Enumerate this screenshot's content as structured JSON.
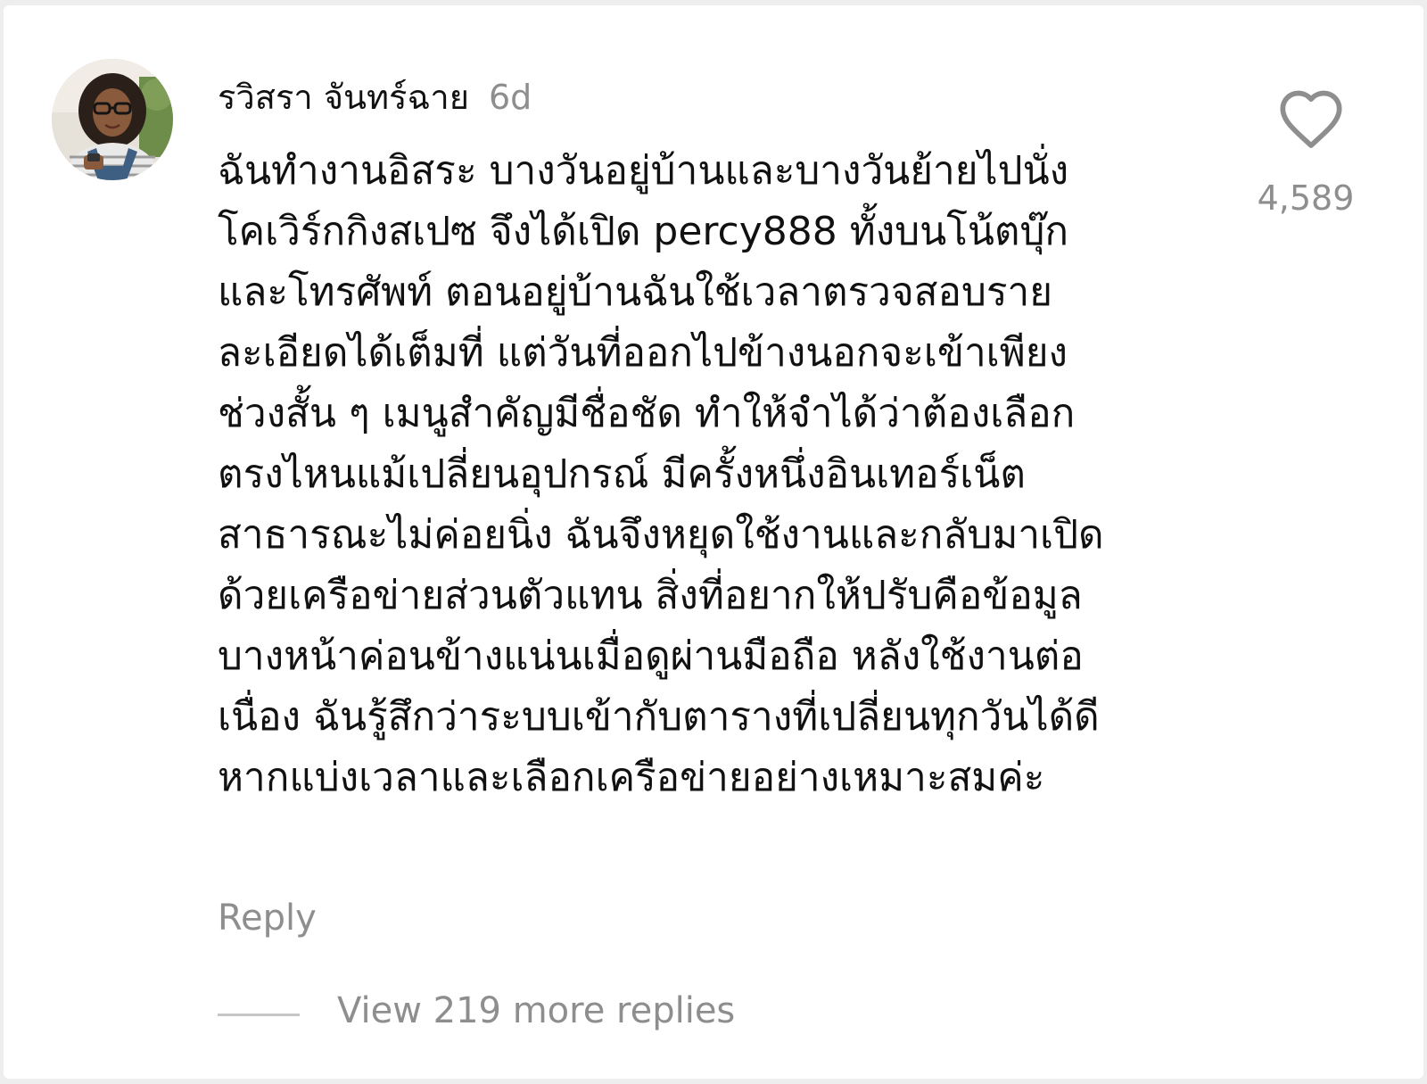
{
  "comment": {
    "username": "รวิสรา จันทร์ฉาย",
    "time": "6d",
    "avatar_icon": "profile-photo",
    "lines": [
      "ฉันทำงานอิสระ บางวันอยู่บ้านและบางวันย้ายไปนั่ง",
      "โคเวิร์กกิงสเปซ จึงได้เปิด percy888 ทั้งบนโน้ตบุ๊ก",
      "และโทรศัพท์ ตอนอยู่บ้านฉันใช้เวลาตรวจสอบราย",
      "ละเอียดได้เต็มที่ แต่วันที่ออกไปข้างนอกจะเข้าเพียง",
      "ช่วงสั้น ๆ เมนูสำคัญมีชื่อชัด ทำให้จำได้ว่าต้องเลือก",
      "ตรงไหนแม้เปลี่ยนอุปกรณ์ มีครั้งหนึ่งอินเทอร์เน็ต",
      "สาธารณะไม่ค่อยนิ่ง ฉันจึงหยุดใช้งานและกลับมาเปิด",
      "ด้วยเครือข่ายส่วนตัวแทน สิ่งที่อยากให้ปรับคือข้อมูล",
      "บางหน้าค่อนข้างแน่นเมื่อดูผ่านมือถือ หลังใช้งานต่อ",
      "เนื่อง ฉันรู้สึกว่าระบบเข้ากับตารางที่เปลี่ยนทุกวันได้ดี",
      "หากแบ่งเวลาและเลือกเครือข่ายอย่างเหมาะสมค่ะ"
    ],
    "like_icon": "heart-outline",
    "like_count": "4,589",
    "reply_label": "Reply",
    "view_replies_label": "View 219 more replies"
  },
  "colors": {
    "text": "#111111",
    "muted": "#8e8e8e",
    "background": "#ffffff"
  }
}
